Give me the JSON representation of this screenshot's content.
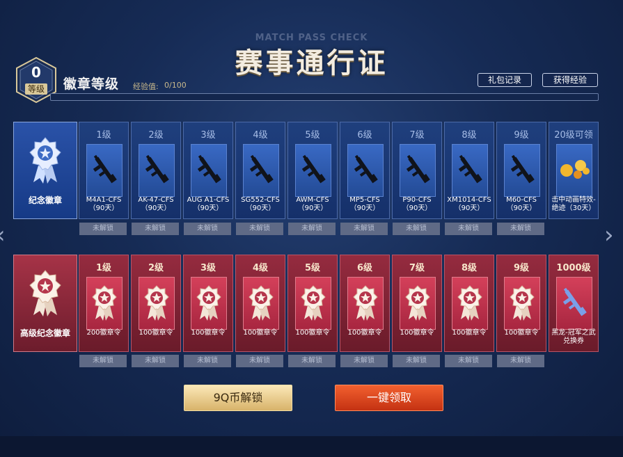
{
  "header": {
    "subtitle": "MATCH PASS CHECK",
    "title": "赛事通行证"
  },
  "level": {
    "value": "0",
    "caption": "等级",
    "rank_title": "徽章等级",
    "exp_label": "经验值:",
    "exp_value": "0/100",
    "exp_progress": 0
  },
  "top_buttons": {
    "gift_log": "礼包记录",
    "get_exp": "获得经验"
  },
  "rows": {
    "basic": {
      "label": "纪念徽章",
      "lock_text": "未解锁",
      "cards": [
        {
          "level": "1级",
          "name": "M4A1-CFS",
          "duration": "（90天）",
          "icon": "rifle-icon"
        },
        {
          "level": "2级",
          "name": "AK-47-CFS",
          "duration": "（90天）",
          "icon": "rifle-icon"
        },
        {
          "level": "3级",
          "name": "AUG A1-CFS",
          "duration": "（90天）",
          "icon": "rifle-icon"
        },
        {
          "level": "4级",
          "name": "SG552-CFS",
          "duration": "（90天）",
          "icon": "rifle-icon"
        },
        {
          "level": "5级",
          "name": "AWM-CFS",
          "duration": "（90天）",
          "icon": "sniper-icon"
        },
        {
          "level": "6级",
          "name": "MP5-CFS",
          "duration": "（90天）",
          "icon": "smg-icon"
        },
        {
          "level": "7级",
          "name": "P90-CFS",
          "duration": "（90天）",
          "icon": "smg-icon"
        },
        {
          "level": "8级",
          "name": "XM1014-CFS",
          "duration": "（90天）",
          "icon": "shotgun-icon"
        },
        {
          "level": "9级",
          "name": "M60-CFS",
          "duration": "（90天）",
          "icon": "machinegun-icon"
        },
        {
          "level": "20级可领",
          "name": "击中动画特效-",
          "duration": "绝迹（30天）",
          "icon": "hit-effect-icon"
        }
      ]
    },
    "premium": {
      "label": "高级纪念徽章",
      "lock_text": "未解锁",
      "cards": [
        {
          "level": "1级",
          "name": "200徽章令",
          "icon": "medal-icon"
        },
        {
          "level": "2级",
          "name": "100徽章令",
          "icon": "medal-icon"
        },
        {
          "level": "3级",
          "name": "100徽章令",
          "icon": "medal-icon"
        },
        {
          "level": "4级",
          "name": "100徽章令",
          "icon": "medal-icon"
        },
        {
          "level": "5级",
          "name": "100徽章令",
          "icon": "medal-icon"
        },
        {
          "level": "6级",
          "name": "100徽章令",
          "icon": "medal-icon"
        },
        {
          "level": "7级",
          "name": "100徽章令",
          "icon": "medal-icon"
        },
        {
          "level": "8级",
          "name": "100徽章令",
          "icon": "medal-icon"
        },
        {
          "level": "9级",
          "name": "100徽章令",
          "icon": "medal-icon"
        },
        {
          "level": "1000级",
          "name": "黑龙-冠军之武",
          "duration": "兑换券",
          "icon": "rifle-icon"
        }
      ]
    }
  },
  "actions": {
    "unlock": "9Q币解锁",
    "claim_all": "一键领取"
  },
  "colors": {
    "background": "#162b55",
    "gold": "#d9c89a",
    "blue_card": "#1f3f7d",
    "red_card": "#952b3f",
    "claim_button": "#e34a22"
  }
}
